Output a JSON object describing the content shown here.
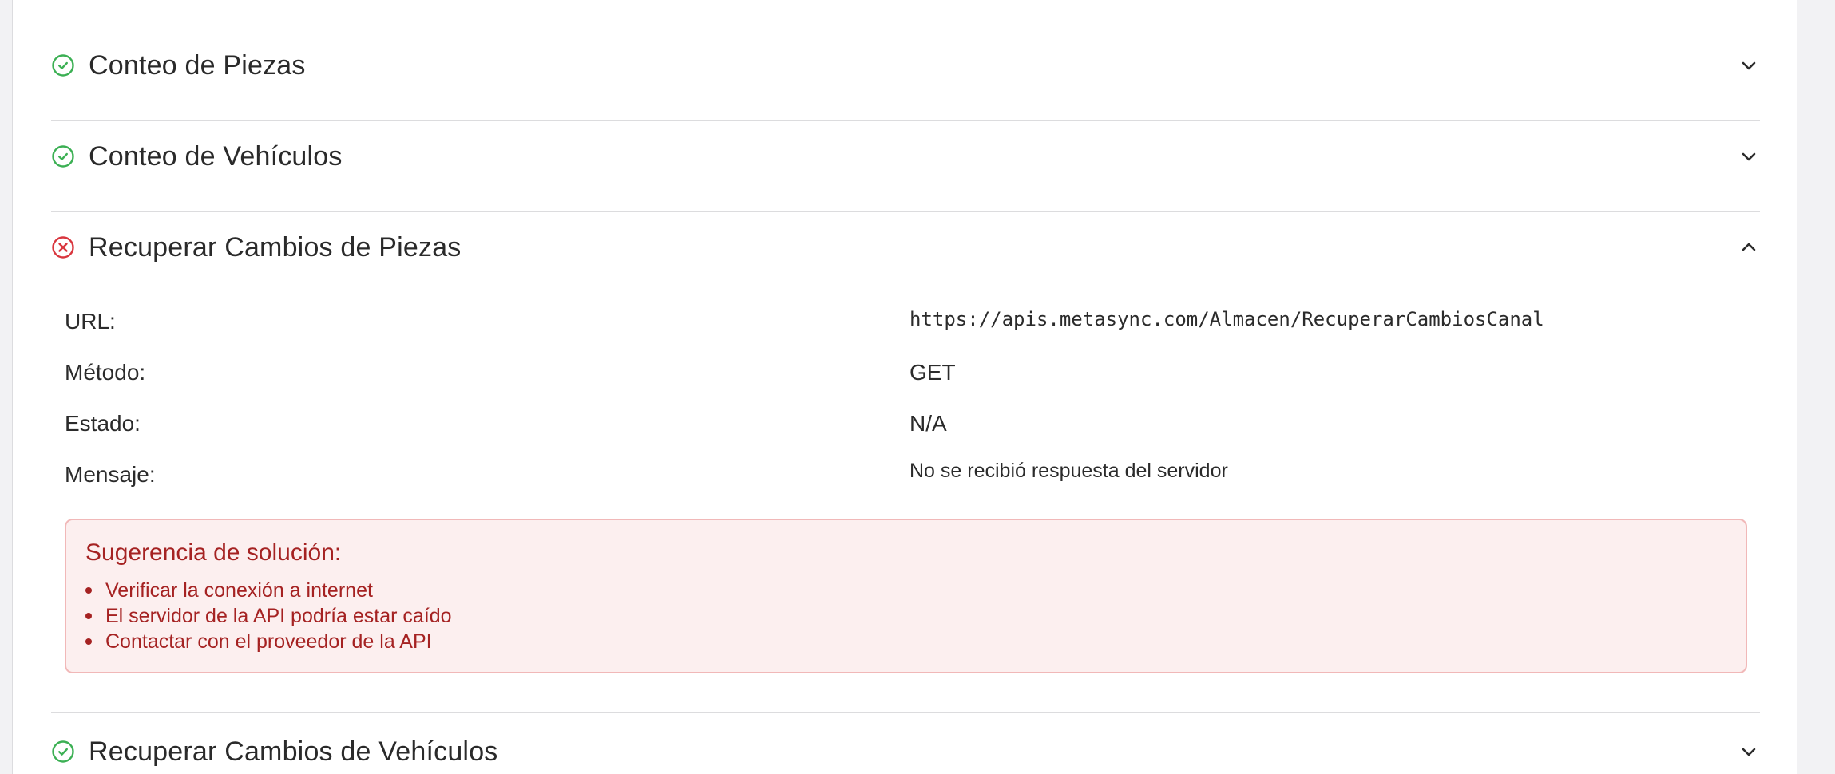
{
  "sections": [
    {
      "title": "Conteo de Piezas",
      "status": "success",
      "expanded": false,
      "status_icon": "check-circle-icon",
      "toggle_icon": "chevron-down-icon"
    },
    {
      "title": "Conteo de Vehículos",
      "status": "success",
      "expanded": false,
      "status_icon": "check-circle-icon",
      "toggle_icon": "chevron-down-icon"
    },
    {
      "title": "Recuperar Cambios de Piezas",
      "status": "error",
      "expanded": true,
      "status_icon": "x-circle-icon",
      "toggle_icon": "chevron-up-icon",
      "details": {
        "url_label": "URL:",
        "url_value": "https://apis.metasync.com/Almacen/RecuperarCambiosCanal",
        "method_label": "Método:",
        "method_value": "GET",
        "state_label": "Estado:",
        "state_value": "N/A",
        "message_label": "Mensaje:",
        "message_value": "No se recibió respuesta del servidor"
      },
      "suggestion": {
        "title": "Sugerencia de solución:",
        "items": [
          "Verificar la conexión a internet",
          "El servidor de la API podría estar caído",
          "Contactar con el proveedor de la API"
        ]
      }
    },
    {
      "title": "Recuperar Cambios de Vehículos",
      "status": "success",
      "expanded": false,
      "status_icon": "check-circle-icon",
      "toggle_icon": "chevron-down-icon"
    }
  ],
  "colors": {
    "success": "#3cb054",
    "error": "#d9363e",
    "suggestion_text": "#a52222",
    "suggestion_bg": "#fcefef",
    "suggestion_border": "#f1b8b8"
  }
}
